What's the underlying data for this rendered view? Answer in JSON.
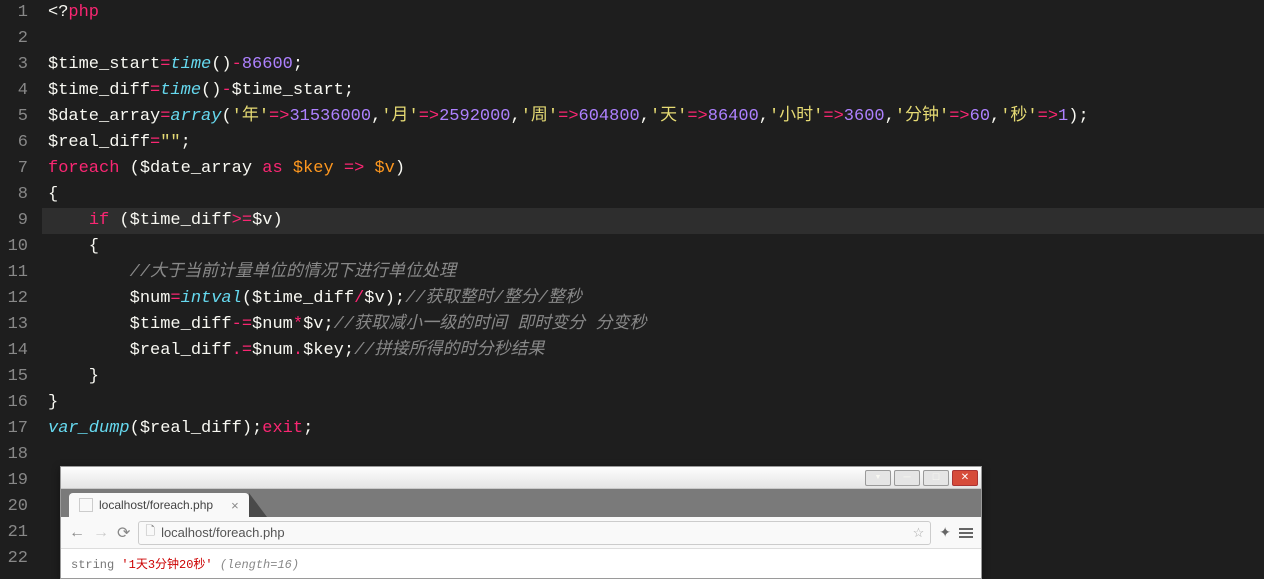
{
  "editor": {
    "lines": [
      {
        "n": 1,
        "tokens": [
          [
            "<?",
            "w"
          ],
          [
            "php",
            "red"
          ]
        ]
      },
      {
        "n": 2,
        "tokens": []
      },
      {
        "n": 3,
        "tokens": [
          [
            "$time_start",
            "w"
          ],
          [
            "=",
            "red"
          ],
          [
            "time",
            "blue"
          ],
          [
            "()",
            "w"
          ],
          [
            "-",
            "red"
          ],
          [
            "86600",
            "purple"
          ],
          [
            ";",
            "w"
          ]
        ]
      },
      {
        "n": 4,
        "tokens": [
          [
            "$time_diff",
            "w"
          ],
          [
            "=",
            "red"
          ],
          [
            "time",
            "blue"
          ],
          [
            "()",
            "w"
          ],
          [
            "-",
            "red"
          ],
          [
            "$time_start",
            "w"
          ],
          [
            ";",
            "w"
          ]
        ]
      },
      {
        "n": 5,
        "tokens": [
          [
            "$date_array",
            "w"
          ],
          [
            "=",
            "red"
          ],
          [
            "array",
            "blue"
          ],
          [
            "(",
            "w"
          ],
          [
            "'年'",
            "yellow"
          ],
          [
            "=>",
            "red"
          ],
          [
            "31536000",
            "purple"
          ],
          [
            ",",
            "w"
          ],
          [
            "'月'",
            "yellow"
          ],
          [
            "=>",
            "red"
          ],
          [
            "2592000",
            "purple"
          ],
          [
            ",",
            "w"
          ],
          [
            "'周'",
            "yellow"
          ],
          [
            "=>",
            "red"
          ],
          [
            "604800",
            "purple"
          ],
          [
            ",",
            "w"
          ],
          [
            "'天'",
            "yellow"
          ],
          [
            "=>",
            "red"
          ],
          [
            "86400",
            "purple"
          ],
          [
            ",",
            "w"
          ],
          [
            "'小时'",
            "yellow"
          ],
          [
            "=>",
            "red"
          ],
          [
            "3600",
            "purple"
          ],
          [
            ",",
            "w"
          ],
          [
            "'分钟'",
            "yellow"
          ],
          [
            "=>",
            "red"
          ],
          [
            "60",
            "purple"
          ],
          [
            ",",
            "w"
          ],
          [
            "'秒'",
            "yellow"
          ],
          [
            "=>",
            "red"
          ],
          [
            "1",
            "purple"
          ],
          [
            ");",
            "w"
          ]
        ]
      },
      {
        "n": 6,
        "tokens": [
          [
            "$real_diff",
            "w"
          ],
          [
            "=",
            "red"
          ],
          [
            "\"\"",
            "yellow"
          ],
          [
            ";",
            "w"
          ]
        ]
      },
      {
        "n": 7,
        "tokens": [
          [
            "foreach",
            "red"
          ],
          [
            " (",
            "w"
          ],
          [
            "$date_array",
            "w"
          ],
          [
            " ",
            "w"
          ],
          [
            "as",
            "red"
          ],
          [
            " ",
            "w"
          ],
          [
            "$key",
            "orange"
          ],
          [
            " ",
            "w"
          ],
          [
            "=>",
            "red"
          ],
          [
            " ",
            "w"
          ],
          [
            "$v",
            "orange"
          ],
          [
            ")",
            "w"
          ]
        ]
      },
      {
        "n": 8,
        "tokens": [
          [
            "{",
            "w"
          ]
        ]
      },
      {
        "n": 9,
        "hl": true,
        "tokens": [
          [
            "    ",
            "w"
          ],
          [
            "if",
            "red"
          ],
          [
            " (",
            "w"
          ],
          [
            "$time_diff",
            "w"
          ],
          [
            ">=",
            "red"
          ],
          [
            "$v",
            "w"
          ],
          [
            ")",
            "w"
          ]
        ]
      },
      {
        "n": 10,
        "tokens": [
          [
            "    {",
            "w"
          ]
        ]
      },
      {
        "n": 11,
        "tokens": [
          [
            "        ",
            "w"
          ],
          [
            "//大于当前计量单位的情况下进行单位处理",
            "gray"
          ]
        ]
      },
      {
        "n": 12,
        "tokens": [
          [
            "        $num",
            "w"
          ],
          [
            "=",
            "red"
          ],
          [
            "intval",
            "blue"
          ],
          [
            "(",
            "w"
          ],
          [
            "$time_diff",
            "w"
          ],
          [
            "/",
            "red"
          ],
          [
            "$v",
            "w"
          ],
          [
            ");",
            "w"
          ],
          [
            "//获取整时/整分/整秒",
            "gray"
          ]
        ]
      },
      {
        "n": 13,
        "tokens": [
          [
            "        $time_diff",
            "w"
          ],
          [
            "-=",
            "red"
          ],
          [
            "$num",
            "w"
          ],
          [
            "*",
            "red"
          ],
          [
            "$v",
            "w"
          ],
          [
            ";",
            "w"
          ],
          [
            "//获取减小一级的时间 即时变分 分变秒",
            "gray"
          ]
        ]
      },
      {
        "n": 14,
        "tokens": [
          [
            "        $real_diff",
            "w"
          ],
          [
            ".=",
            "red"
          ],
          [
            "$num",
            "w"
          ],
          [
            ".",
            "red"
          ],
          [
            "$key",
            "w"
          ],
          [
            ";",
            "w"
          ],
          [
            "//拼接所得的时分秒结果",
            "gray"
          ]
        ]
      },
      {
        "n": 15,
        "tokens": [
          [
            "    }",
            "w"
          ]
        ]
      },
      {
        "n": 16,
        "tokens": [
          [
            "}",
            "w"
          ]
        ]
      },
      {
        "n": 17,
        "tokens": [
          [
            "var_dump",
            "blue"
          ],
          [
            "(",
            "w"
          ],
          [
            "$real_diff",
            "w"
          ],
          [
            ");",
            "w"
          ],
          [
            "exit",
            "red"
          ],
          [
            ";",
            "w"
          ]
        ]
      },
      {
        "n": 18,
        "tokens": []
      },
      {
        "n": 19,
        "tokens": []
      },
      {
        "n": 20,
        "tokens": []
      },
      {
        "n": 21,
        "tokens": []
      },
      {
        "n": 22,
        "tokens": []
      }
    ]
  },
  "browser": {
    "tab_title": "localhost/foreach.php",
    "url": "localhost/foreach.php",
    "output": {
      "type_label": "string",
      "value": "'1天3分钟20秒'",
      "length_label": "(length=16)"
    }
  }
}
